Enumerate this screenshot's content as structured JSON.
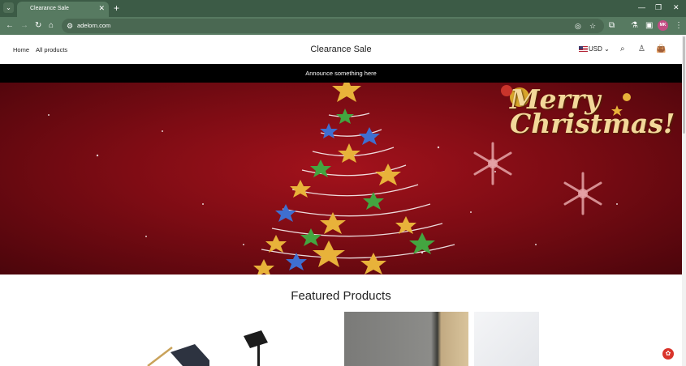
{
  "browser": {
    "tab_title": "Clearance Sale",
    "url": "adelorn.com",
    "profile_initials": "MK",
    "tab_list_icon": "chevron-down-icon",
    "close_tab_icon": "close-icon",
    "new_tab_icon": "plus-icon"
  },
  "header": {
    "nav": [
      "Home",
      "All products"
    ],
    "store_title": "Clearance Sale",
    "currency": "USD"
  },
  "announcement": "Announce something here",
  "hero": {
    "greeting_line1": "Merry",
    "greeting_line2": "Christmas!"
  },
  "section": {
    "title": "Featured Products"
  },
  "colors": {
    "browser_frame": "#3c5b46",
    "announcement_bar": "#000000",
    "hero_red": "#8f0f18",
    "greeting_gold": "#f3d89a"
  }
}
